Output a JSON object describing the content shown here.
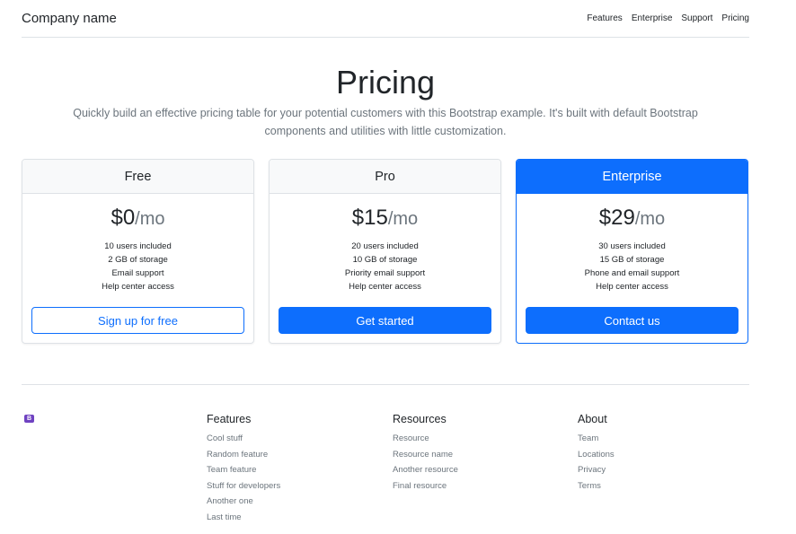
{
  "header": {
    "brand": "Company name",
    "nav": [
      "Features",
      "Enterprise",
      "Support",
      "Pricing"
    ]
  },
  "hero": {
    "title": "Pricing",
    "lead": "Quickly build an effective pricing table for your potential customers with this Bootstrap example. It's built with default Bootstrap components and utilities with little customization."
  },
  "plans": [
    {
      "name": "Free",
      "price": "$0",
      "period": "/mo",
      "features": [
        "10 users included",
        "2 GB of storage",
        "Email support",
        "Help center access"
      ],
      "button": "Sign up for free",
      "button_style": "outline"
    },
    {
      "name": "Pro",
      "price": "$15",
      "period": "/mo",
      "features": [
        "20 users included",
        "10 GB of storage",
        "Priority email support",
        "Help center access"
      ],
      "button": "Get started",
      "button_style": "solid"
    },
    {
      "name": "Enterprise",
      "price": "$29",
      "period": "/mo",
      "features": [
        "30 users included",
        "15 GB of storage",
        "Phone and email support",
        "Help center access"
      ],
      "button": "Contact us",
      "button_style": "solid",
      "highlighted": true
    }
  ],
  "footer": {
    "logo_icon": "bootstrap-icon",
    "logo_glyph": "B",
    "columns": [
      {
        "title": "Features",
        "links": [
          "Cool stuff",
          "Random feature",
          "Team feature",
          "Stuff for developers",
          "Another one",
          "Last time"
        ]
      },
      {
        "title": "Resources",
        "links": [
          "Resource",
          "Resource name",
          "Another resource",
          "Final resource"
        ]
      },
      {
        "title": "About",
        "links": [
          "Team",
          "Locations",
          "Privacy",
          "Terms"
        ]
      }
    ]
  },
  "colors": {
    "primary": "#0d6efd",
    "muted": "#6c757d",
    "border": "#dee2e6",
    "logo": "#6f42c1"
  }
}
